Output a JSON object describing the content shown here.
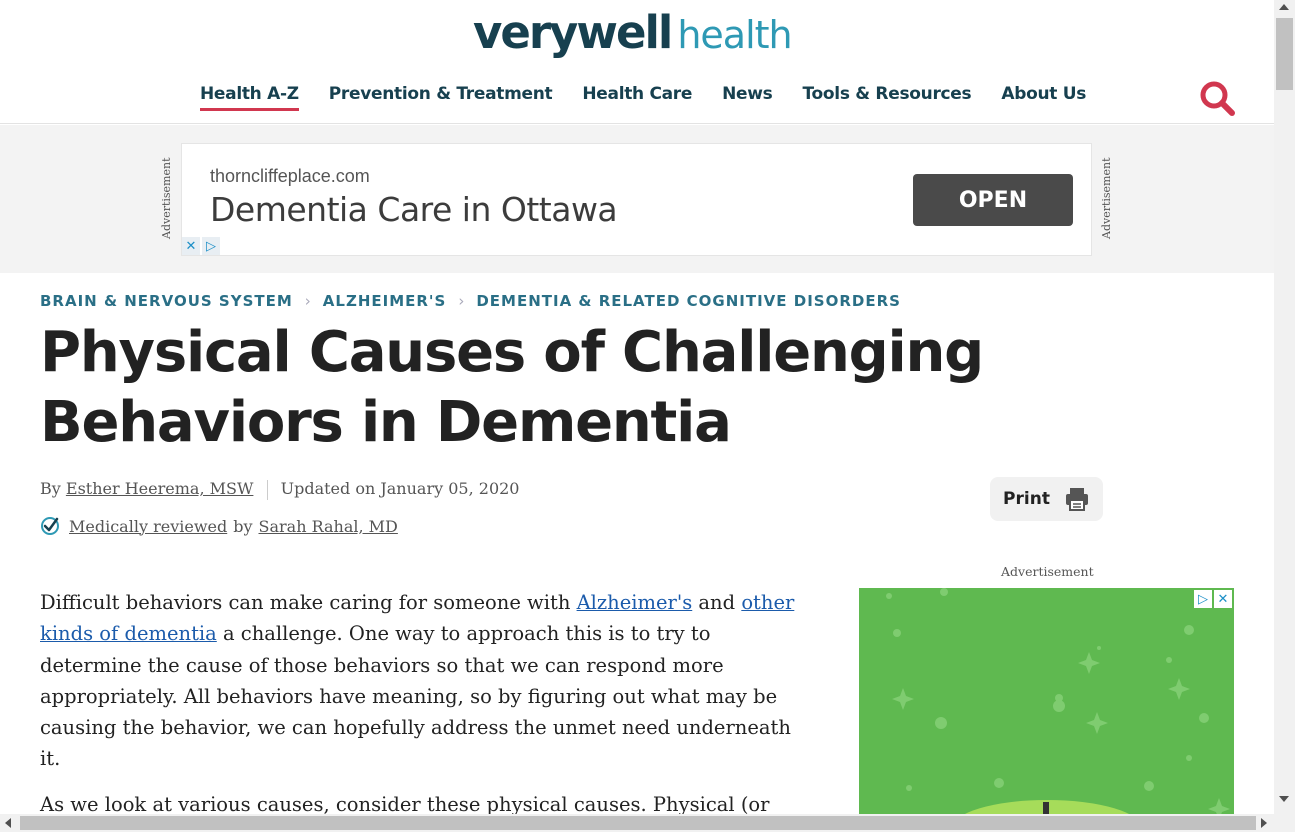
{
  "header": {
    "logo_part1": "verywell",
    "logo_part2": "health",
    "nav": [
      {
        "label": "Health A-Z",
        "active": true
      },
      {
        "label": "Prevention & Treatment"
      },
      {
        "label": "Health Care"
      },
      {
        "label": "News"
      },
      {
        "label": "Tools & Resources"
      },
      {
        "label": "About Us"
      }
    ],
    "search_icon": "search-icon"
  },
  "top_ad": {
    "side_label": "Advertisement",
    "domain": "thorncliffeplace.com",
    "headline": "Dementia Care in Ottawa",
    "cta": "OPEN",
    "close_glyph": "✕",
    "info_glyph": "▷"
  },
  "breadcrumb": [
    "BRAIN & NERVOUS SYSTEM",
    "ALZHEIMER'S",
    "DEMENTIA & RELATED COGNITIVE DISORDERS"
  ],
  "article": {
    "title": "Physical Causes of Challenging Behaviors in Dementia",
    "byline": {
      "by": "By",
      "author": "Esther Heerema, MSW",
      "updated": "Updated on January 05, 2020"
    },
    "review": {
      "link_text": "Medically reviewed",
      "by": "by",
      "reviewer": "Sarah Rahal, MD"
    },
    "print_label": "Print",
    "paragraph1": {
      "t1": "Difficult behaviors can make caring for someone with ",
      "link1": "Alzheimer's",
      "t2": " and ",
      "link2": "other kinds of dementia",
      "t3": " a challenge. One way to approach this is to try to determine the cause of those behaviors so that we can respond more appropriately. All behaviors have meaning, so by figuring out what may be causing the behavior, we can hopefully address the unmet need underneath it."
    },
    "paragraph2": "As we look at various causes, consider these physical causes. Physical (or"
  },
  "side_ad": {
    "label": "Advertisement",
    "background": "#5fb950"
  },
  "colors": {
    "brand_dark": "#17404f",
    "brand_light": "#2e99b4",
    "accent": "#d1374f",
    "link": "#1b5bab"
  }
}
